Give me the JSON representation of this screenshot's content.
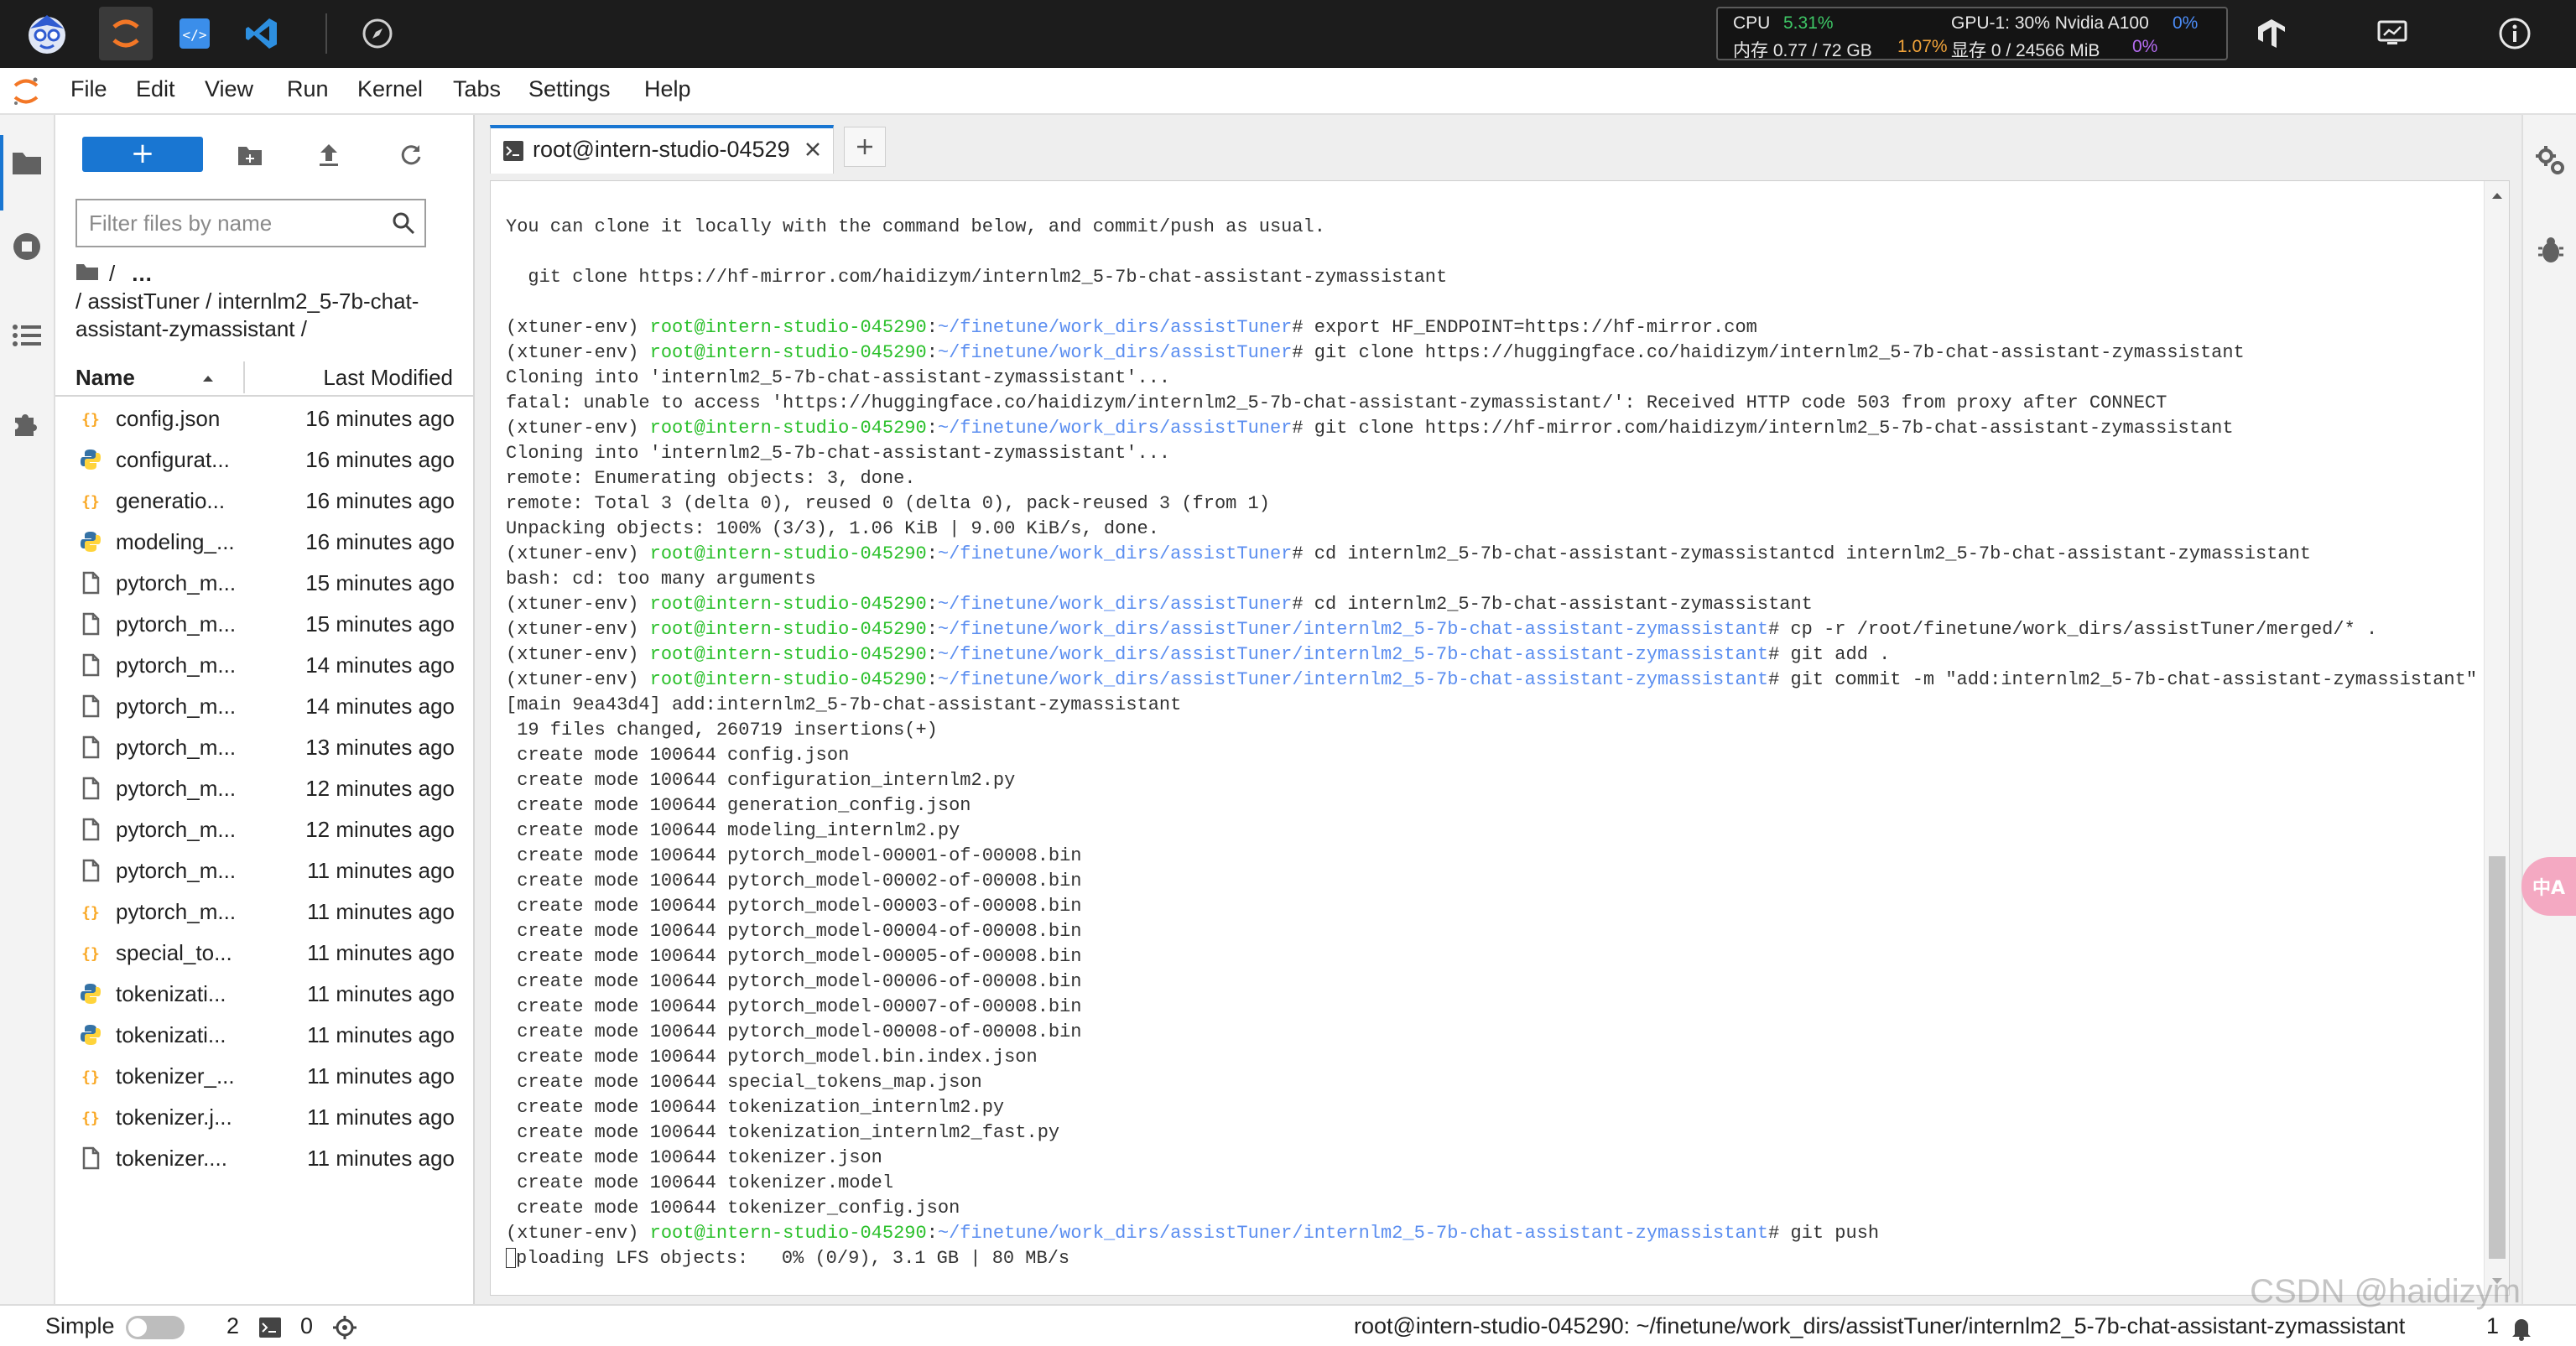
{
  "topbar": {
    "resources": {
      "cpu_label": "CPU",
      "cpu_value": "5.31%",
      "mem_label": "内存 0.77 / 72 GB",
      "mem_value": "1.07%",
      "gpu_label": "GPU-1: 30% Nvidia A100",
      "gpu_value": "0%",
      "vram_label": "显存 0 / 24566 MiB",
      "vram_value": "0%"
    }
  },
  "menu": {
    "items": [
      "File",
      "Edit",
      "View",
      "Run",
      "Kernel",
      "Tabs",
      "Settings",
      "Help"
    ]
  },
  "filebrowser": {
    "new_button": "+",
    "search_placeholder": "Filter files by name",
    "breadcrumb_root": "/",
    "breadcrumb_more": "...",
    "breadcrumb_path": "/ assistTuner / internlm2_5-7b-chat-assistant-zymassistant /",
    "col_name": "Name",
    "col_modified": "Last Modified",
    "files": [
      {
        "name": "config.json",
        "modified": "16 minutes ago",
        "icon": "json-icon"
      },
      {
        "name": "configurat...",
        "modified": "16 minutes ago",
        "icon": "python-icon"
      },
      {
        "name": "generatio...",
        "modified": "16 minutes ago",
        "icon": "json-icon"
      },
      {
        "name": "modeling_...",
        "modified": "16 minutes ago",
        "icon": "python-icon"
      },
      {
        "name": "pytorch_m...",
        "modified": "15 minutes ago",
        "icon": "file-icon"
      },
      {
        "name": "pytorch_m...",
        "modified": "15 minutes ago",
        "icon": "file-icon"
      },
      {
        "name": "pytorch_m...",
        "modified": "14 minutes ago",
        "icon": "file-icon"
      },
      {
        "name": "pytorch_m...",
        "modified": "14 minutes ago",
        "icon": "file-icon"
      },
      {
        "name": "pytorch_m...",
        "modified": "13 minutes ago",
        "icon": "file-icon"
      },
      {
        "name": "pytorch_m...",
        "modified": "12 minutes ago",
        "icon": "file-icon"
      },
      {
        "name": "pytorch_m...",
        "modified": "12 minutes ago",
        "icon": "file-icon"
      },
      {
        "name": "pytorch_m...",
        "modified": "11 minutes ago",
        "icon": "file-icon"
      },
      {
        "name": "pytorch_m...",
        "modified": "11 minutes ago",
        "icon": "json-icon"
      },
      {
        "name": "special_to...",
        "modified": "11 minutes ago",
        "icon": "json-icon"
      },
      {
        "name": "tokenizati...",
        "modified": "11 minutes ago",
        "icon": "python-icon"
      },
      {
        "name": "tokenizati...",
        "modified": "11 minutes ago",
        "icon": "python-icon"
      },
      {
        "name": "tokenizer_...",
        "modified": "11 minutes ago",
        "icon": "json-icon"
      },
      {
        "name": "tokenizer.j...",
        "modified": "11 minutes ago",
        "icon": "json-icon"
      },
      {
        "name": "tokenizer....",
        "modified": "11 minutes ago",
        "icon": "file-icon"
      }
    ]
  },
  "tab": {
    "label": "root@intern-studio-04529"
  },
  "terminal": {
    "lines": [
      [
        {
          "t": "You can clone it locally with the command below, and commit/push as usual."
        }
      ],
      [
        {
          "t": ""
        }
      ],
      [
        {
          "t": "  git clone https://hf-mirror.com/haidizym/internlm2_5-7b-chat-assistant-zymassistant"
        }
      ],
      [
        {
          "t": ""
        }
      ],
      [
        {
          "t": "(xtuner-env) "
        },
        {
          "t": "root@intern-studio-045290",
          "c": "g"
        },
        {
          "t": ":"
        },
        {
          "t": "~/finetune/work_dirs/assistTuner",
          "c": "b"
        },
        {
          "t": "# export HF_ENDPOINT=https://hf-mirror.com"
        }
      ],
      [
        {
          "t": "(xtuner-env) "
        },
        {
          "t": "root@intern-studio-045290",
          "c": "g"
        },
        {
          "t": ":"
        },
        {
          "t": "~/finetune/work_dirs/assistTuner",
          "c": "b"
        },
        {
          "t": "# git clone https://huggingface.co/haidizym/internlm2_5-7b-chat-assistant-zymassistant"
        }
      ],
      [
        {
          "t": "Cloning into 'internlm2_5-7b-chat-assistant-zymassistant'..."
        }
      ],
      [
        {
          "t": "fatal: unable to access 'https://huggingface.co/haidizym/internlm2_5-7b-chat-assistant-zymassistant/': Received HTTP code 503 from proxy after CONNECT"
        }
      ],
      [
        {
          "t": "(xtuner-env) "
        },
        {
          "t": "root@intern-studio-045290",
          "c": "g"
        },
        {
          "t": ":"
        },
        {
          "t": "~/finetune/work_dirs/assistTuner",
          "c": "b"
        },
        {
          "t": "# git clone https://hf-mirror.com/haidizym/internlm2_5-7b-chat-assistant-zymassistant"
        }
      ],
      [
        {
          "t": "Cloning into 'internlm2_5-7b-chat-assistant-zymassistant'..."
        }
      ],
      [
        {
          "t": "remote: Enumerating objects: 3, done."
        }
      ],
      [
        {
          "t": "remote: Total 3 (delta 0), reused 0 (delta 0), pack-reused 3 (from 1)"
        }
      ],
      [
        {
          "t": "Unpacking objects: 100% (3/3), 1.06 KiB | 9.00 KiB/s, done."
        }
      ],
      [
        {
          "t": "(xtuner-env) "
        },
        {
          "t": "root@intern-studio-045290",
          "c": "g"
        },
        {
          "t": ":"
        },
        {
          "t": "~/finetune/work_dirs/assistTuner",
          "c": "b"
        },
        {
          "t": "# cd internlm2_5-7b-chat-assistant-zymassistantcd internlm2_5-7b-chat-assistant-zymassistant"
        }
      ],
      [
        {
          "t": "bash: cd: too many arguments"
        }
      ],
      [
        {
          "t": "(xtuner-env) "
        },
        {
          "t": "root@intern-studio-045290",
          "c": "g"
        },
        {
          "t": ":"
        },
        {
          "t": "~/finetune/work_dirs/assistTuner",
          "c": "b"
        },
        {
          "t": "# cd internlm2_5-7b-chat-assistant-zymassistant"
        }
      ],
      [
        {
          "t": "(xtuner-env) "
        },
        {
          "t": "root@intern-studio-045290",
          "c": "g"
        },
        {
          "t": ":"
        },
        {
          "t": "~/finetune/work_dirs/assistTuner/internlm2_5-7b-chat-assistant-zymassistant",
          "c": "b"
        },
        {
          "t": "# cp -r /root/finetune/work_dirs/assistTuner/merged/* ."
        }
      ],
      [
        {
          "t": "(xtuner-env) "
        },
        {
          "t": "root@intern-studio-045290",
          "c": "g"
        },
        {
          "t": ":"
        },
        {
          "t": "~/finetune/work_dirs/assistTuner/internlm2_5-7b-chat-assistant-zymassistant",
          "c": "b"
        },
        {
          "t": "# git add ."
        }
      ],
      [
        {
          "t": "(xtuner-env) "
        },
        {
          "t": "root@intern-studio-045290",
          "c": "g"
        },
        {
          "t": ":"
        },
        {
          "t": "~/finetune/work_dirs/assistTuner/internlm2_5-7b-chat-assistant-zymassistant",
          "c": "b"
        },
        {
          "t": "# git commit -m \"add:internlm2_5-7b-chat-assistant-zymassistant\""
        }
      ],
      [
        {
          "t": "[main 9ea43d4] add:internlm2_5-7b-chat-assistant-zymassistant"
        }
      ],
      [
        {
          "t": " 19 files changed, 260719 insertions(+)"
        }
      ],
      [
        {
          "t": " create mode 100644 config.json"
        }
      ],
      [
        {
          "t": " create mode 100644 configuration_internlm2.py"
        }
      ],
      [
        {
          "t": " create mode 100644 generation_config.json"
        }
      ],
      [
        {
          "t": " create mode 100644 modeling_internlm2.py"
        }
      ],
      [
        {
          "t": " create mode 100644 pytorch_model-00001-of-00008.bin"
        }
      ],
      [
        {
          "t": " create mode 100644 pytorch_model-00002-of-00008.bin"
        }
      ],
      [
        {
          "t": " create mode 100644 pytorch_model-00003-of-00008.bin"
        }
      ],
      [
        {
          "t": " create mode 100644 pytorch_model-00004-of-00008.bin"
        }
      ],
      [
        {
          "t": " create mode 100644 pytorch_model-00005-of-00008.bin"
        }
      ],
      [
        {
          "t": " create mode 100644 pytorch_model-00006-of-00008.bin"
        }
      ],
      [
        {
          "t": " create mode 100644 pytorch_model-00007-of-00008.bin"
        }
      ],
      [
        {
          "t": " create mode 100644 pytorch_model-00008-of-00008.bin"
        }
      ],
      [
        {
          "t": " create mode 100644 pytorch_model.bin.index.json"
        }
      ],
      [
        {
          "t": " create mode 100644 special_tokens_map.json"
        }
      ],
      [
        {
          "t": " create mode 100644 tokenization_internlm2.py"
        }
      ],
      [
        {
          "t": " create mode 100644 tokenization_internlm2_fast.py"
        }
      ],
      [
        {
          "t": " create mode 100644 tokenizer.json"
        }
      ],
      [
        {
          "t": " create mode 100644 tokenizer.model"
        }
      ],
      [
        {
          "t": " create mode 100644 tokenizer_config.json"
        }
      ],
      [
        {
          "t": "(xtuner-env) "
        },
        {
          "t": "root@intern-studio-045290",
          "c": "g"
        },
        {
          "t": ":"
        },
        {
          "t": "~/finetune/work_dirs/assistTuner/internlm2_5-7b-chat-assistant-zymassistant",
          "c": "b"
        },
        {
          "t": "# git push"
        }
      ],
      [
        {
          "t": "",
          "cursor": true
        },
        {
          "t": "ploading LFS objects:   0% (0/9), 3.1 GB | 80 MB/s"
        }
      ]
    ]
  },
  "statusbar": {
    "mode_label": "Simple",
    "terminals_count": "2",
    "kernels_count": "0",
    "path": "root@intern-studio-045290: ~/finetune/work_dirs/assistTuner/internlm2_5-7b-chat-assistant-zymassistant",
    "notifications_count": "1"
  },
  "watermark": "CSDN @haidizym",
  "translate_label": "中A",
  "colors": {
    "accent": "#1976d2",
    "prompt_user": "#2bc02b",
    "prompt_path": "#5b8ef0"
  }
}
